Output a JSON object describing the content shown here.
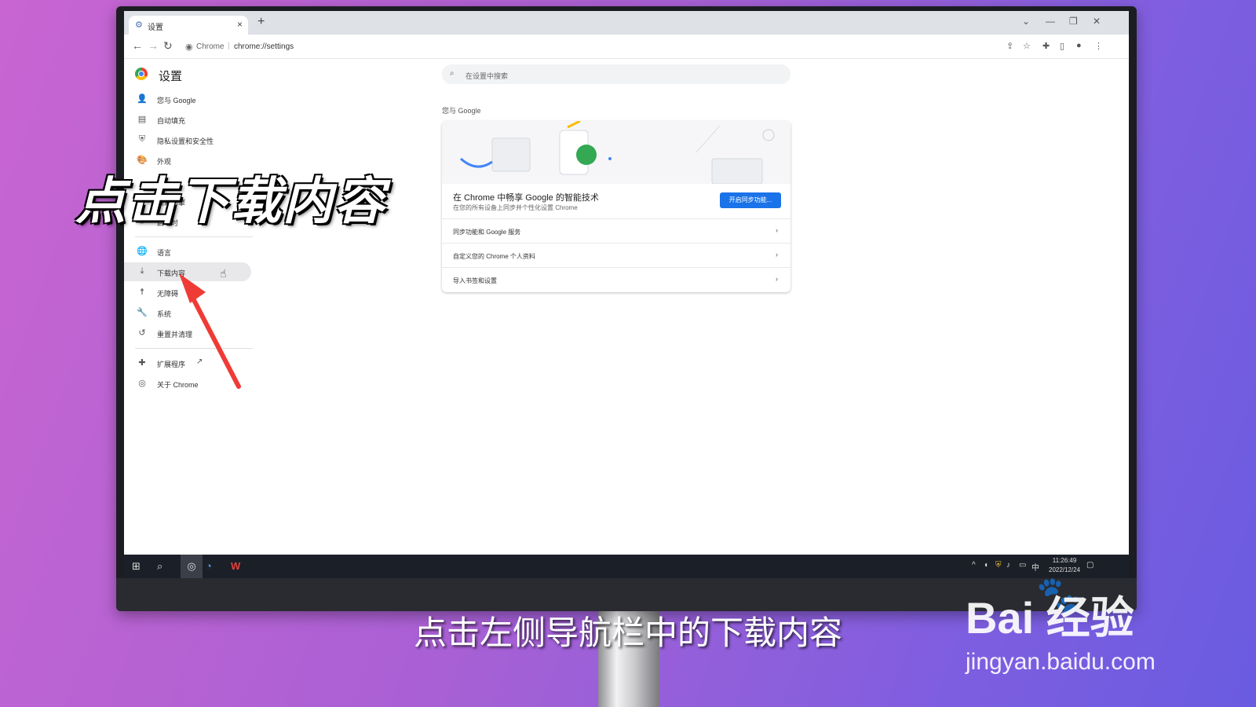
{
  "browser": {
    "tab_title": "设置",
    "tab_close": "×",
    "new_tab": "+",
    "omnibox_site": "Chrome",
    "omnibox_url": "chrome://settings"
  },
  "settings": {
    "title": "设置",
    "search_placeholder": "在设置中搜索",
    "nav_items": [
      {
        "label": "您与 Google",
        "icon": "person-icon"
      },
      {
        "label": "自动填充",
        "icon": "clipboard-icon"
      },
      {
        "label": "隐私设置和安全性",
        "icon": "shield-icon"
      },
      {
        "label": "外观",
        "icon": "palette-icon"
      },
      {
        "label": "搜索引擎",
        "icon": "search-icon"
      },
      {
        "label": "启动时",
        "icon": "power-icon"
      },
      {
        "label": "语言",
        "icon": "globe-icon"
      },
      {
        "label": "下载内容",
        "icon": "download-icon",
        "active": true
      },
      {
        "label": "无障碍",
        "icon": "accessibility-icon"
      },
      {
        "label": "系统",
        "icon": "wrench-icon"
      },
      {
        "label": "重置并清理",
        "icon": "history-icon"
      },
      {
        "label": "扩展程序",
        "icon": "puzzle-icon"
      },
      {
        "label": "关于 Chrome",
        "icon": "chrome-icon"
      }
    ],
    "section_heading": "您与 Google",
    "promo_title": "在 Chrome 中畅享 Google 的智能技术",
    "promo_subtitle": "在您的所有设备上同步并个性化设置 Chrome",
    "sync_button": "开启同步功能...",
    "rows": [
      "同步功能和 Google 服务",
      "自定义您的 Chrome 个人资料",
      "导入书签和设置"
    ]
  },
  "taskbar": {
    "ime": "中",
    "time": "11:26:49",
    "date": "2022/12/24"
  },
  "overlay": {
    "title": "点击下载内容",
    "subtitle": "点击左侧导航栏中的下载内容",
    "watermark_brand": "Bai  经验",
    "watermark_url": "jingyan.baidu.com"
  },
  "colors": {
    "accent": "#1a73e8",
    "arrow": "#ef3b36"
  }
}
